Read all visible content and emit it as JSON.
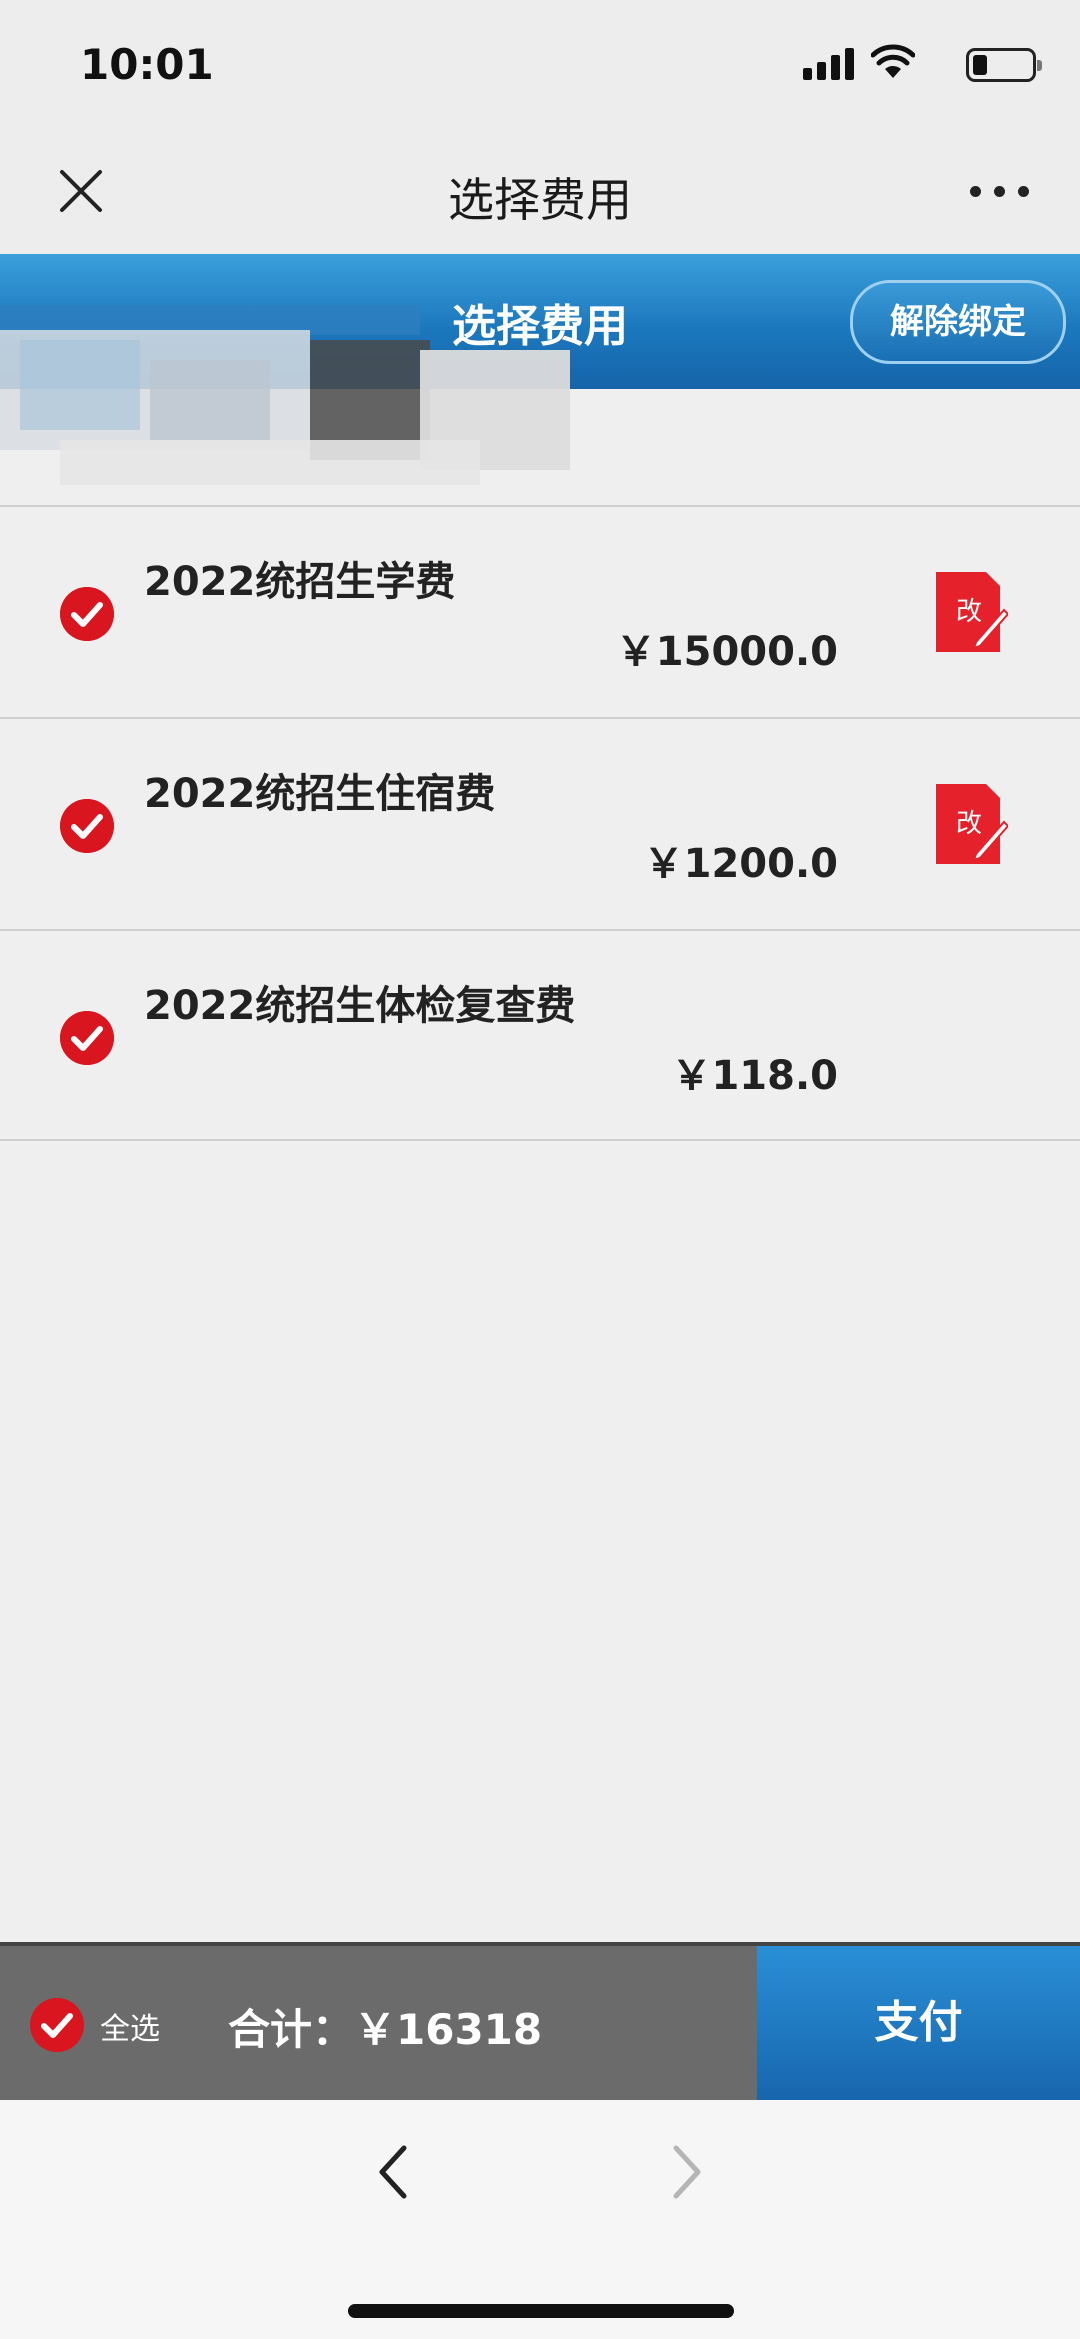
{
  "status_bar": {
    "time": "10:01"
  },
  "nav": {
    "title": "选择费用"
  },
  "banner": {
    "title": "选择费用",
    "unbind_label": "解除绑定"
  },
  "fees": [
    {
      "name": "2022统招生学费",
      "amount": "￥15000.0",
      "checked": true,
      "editable": true,
      "edit_icon_text": "改"
    },
    {
      "name": "2022统招生住宿费",
      "amount": "￥1200.0",
      "checked": true,
      "editable": true,
      "edit_icon_text": "改"
    },
    {
      "name": "2022统招生体检复查费",
      "amount": "￥118.0",
      "checked": true,
      "editable": false
    }
  ],
  "footer": {
    "select_all_label": "全选",
    "total_label": "合计：",
    "total_value": "￥16318",
    "pay_label": "支付"
  },
  "colors": {
    "accent_red": "#d9161f",
    "banner_blue": "#1c78bd",
    "footer_gray": "#6b6b6b"
  }
}
